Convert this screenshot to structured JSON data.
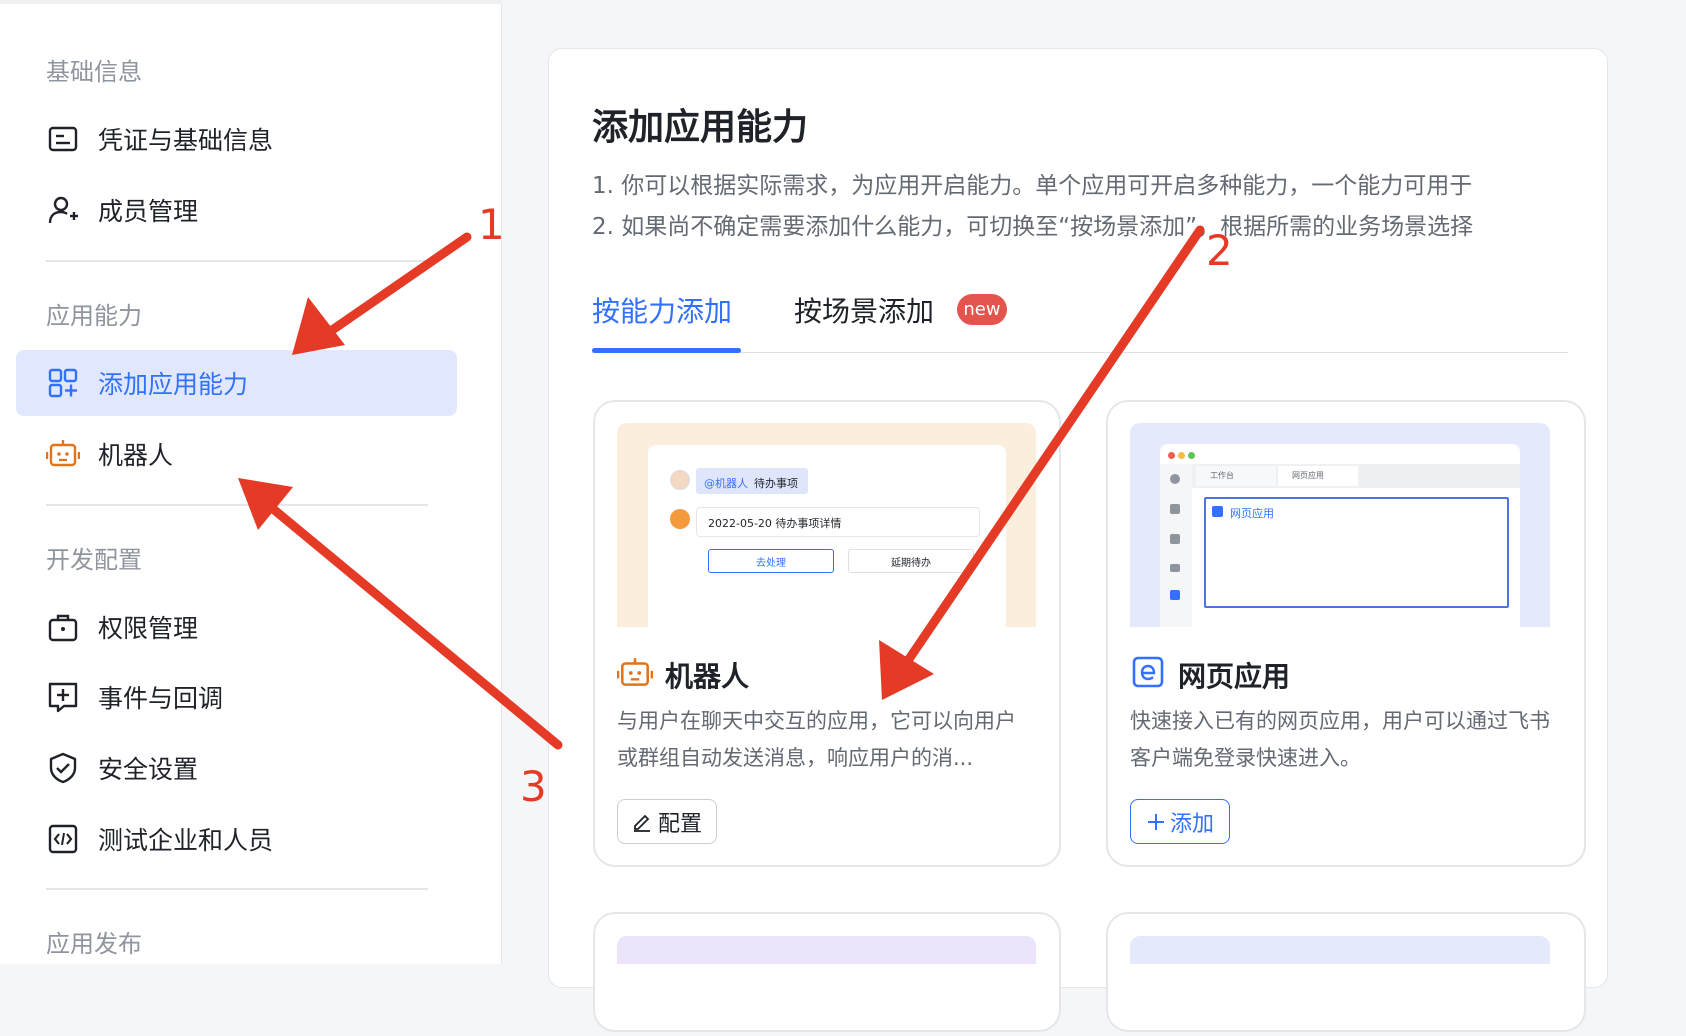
{
  "sidebar": {
    "groups": [
      {
        "title": "基础信息"
      },
      {
        "title": "应用能力"
      },
      {
        "title": "开发配置"
      },
      {
        "title": "应用发布"
      }
    ],
    "items": [
      {
        "label": "凭证与基础信息",
        "icon": "id-card-icon"
      },
      {
        "label": "成员管理",
        "icon": "add-user-icon"
      },
      {
        "label": "添加应用能力",
        "icon": "add-grid-icon",
        "active": true
      },
      {
        "label": "机器人",
        "icon": "robot-icon"
      },
      {
        "label": "权限管理",
        "icon": "briefcase-lock-icon"
      },
      {
        "label": "事件与回调",
        "icon": "plus-square-icon"
      },
      {
        "label": "安全设置",
        "icon": "shield-check-icon"
      },
      {
        "label": "测试企业和人员",
        "icon": "code-frame-icon"
      }
    ]
  },
  "main": {
    "title": "添加应用能力",
    "desc_lines": [
      "1. 你可以根据实际需求，为应用开启能力。单个应用可开启多种能力，一个能力可用于",
      "2. 如果尚不确定需要添加什么能力，可切换至“按场景添加”，根据所需的业务场景选择"
    ],
    "tabs": [
      {
        "label": "按能力添加",
        "active": true
      },
      {
        "label": "按场景添加",
        "badge": "new"
      }
    ],
    "cards": [
      {
        "title": "机器人",
        "icon": "robot-icon",
        "desc": "与用户在聊天中交互的应用，它可以向用户或群组自动发送消息，响应用户的消...",
        "button": "配置",
        "button_icon": "edit-icon",
        "illustration": {
          "mention": "@机器人",
          "todo": "待办事项",
          "detail": "2022-05-20 待办事项详情",
          "btn1": "去处理",
          "btn2": "延期待办"
        }
      },
      {
        "title": "网页应用",
        "icon": "web-app-e-icon",
        "desc": "快速接入已有的网页应用，用户可以通过飞书客户端免登录快速进入。",
        "button": "添加",
        "button_icon": "plus-icon",
        "illustration": {
          "tab1": "工作台",
          "tab2": "网页应用",
          "content": "网页应用"
        }
      }
    ]
  },
  "annotations": {
    "labels": [
      "1",
      "2",
      "3"
    ],
    "color": "#e53a26"
  },
  "colors": {
    "accent": "#3370ff",
    "active_bg": "#e1e8fd",
    "badge": "#e2544c",
    "robot_orange": "#e37318"
  }
}
